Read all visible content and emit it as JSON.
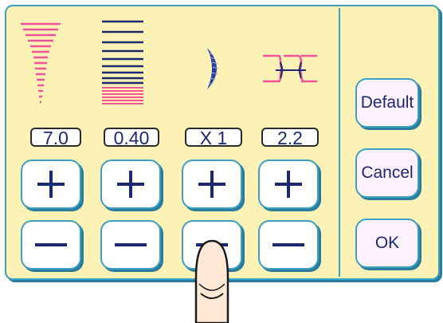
{
  "colors": {
    "panel_bg": "#fcf2b6",
    "panel_border": "#3f9fc0",
    "pink_lines": "#f0559a",
    "navy": "#1c2870",
    "side_button_bg": "#fdf0ff"
  },
  "settings": {
    "stitch_width": {
      "icon": "width-taper-icon",
      "value": "7.0"
    },
    "stitch_length": {
      "icon": "length-lines-icon",
      "value": "0.40"
    },
    "elongation": {
      "icon": "crescent-satin-icon",
      "value": "X 1"
    },
    "tension": {
      "icon": "thread-tension-icon",
      "value": "2.2"
    }
  },
  "controls": {
    "plus_symbol": "+",
    "minus_symbol": "−"
  },
  "side_buttons": {
    "default_label": "Default",
    "cancel_label": "Cancel",
    "ok_label": "OK"
  }
}
